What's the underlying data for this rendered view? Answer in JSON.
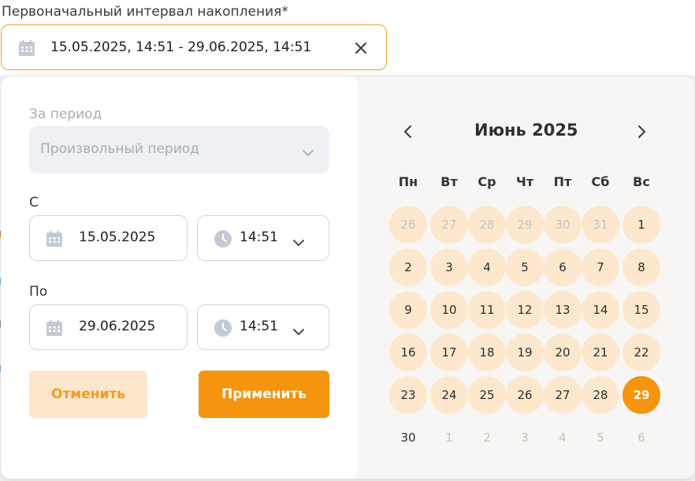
{
  "field": {
    "label": "Первоначальный интервал накопления*",
    "value": "15.05.2025, 14:51 - 29.06.2025, 14:51"
  },
  "period": {
    "label": "За период",
    "selected": "Произвольный период"
  },
  "from": {
    "label": "С",
    "date": "15.05.2025",
    "time": "14:51"
  },
  "to": {
    "label": "По",
    "date": "29.06.2025",
    "time": "14:51"
  },
  "buttons": {
    "cancel": "Отменить",
    "apply": "Применить"
  },
  "calendar": {
    "month_title": "Июнь 2025",
    "weekdays": [
      "Пн",
      "Вт",
      "Ср",
      "Чт",
      "Пт",
      "Сб",
      "Вс"
    ],
    "weeks": [
      [
        "26",
        "27",
        "28",
        "29",
        "30",
        "31",
        "1"
      ],
      [
        "2",
        "3",
        "4",
        "5",
        "6",
        "7",
        "8"
      ],
      [
        "9",
        "10",
        "11",
        "12",
        "13",
        "14",
        "15"
      ],
      [
        "16",
        "17",
        "18",
        "19",
        "20",
        "21",
        "22"
      ],
      [
        "23",
        "24",
        "25",
        "26",
        "27",
        "28",
        "29"
      ],
      [
        "30",
        "1",
        "2",
        "3",
        "4",
        "5",
        "6"
      ]
    ],
    "selected_day": "29",
    "in_range_color": "#fde8cd",
    "selected_color": "#f4940f"
  },
  "colors": {
    "accent": "#f4940f",
    "accent_light": "#fde7cc",
    "focus_border": "#f0a030"
  },
  "icons": {
    "calendar": "calendar-icon",
    "clock": "clock-icon",
    "clear": "close-icon",
    "chevron": "chevron-down-icon"
  }
}
